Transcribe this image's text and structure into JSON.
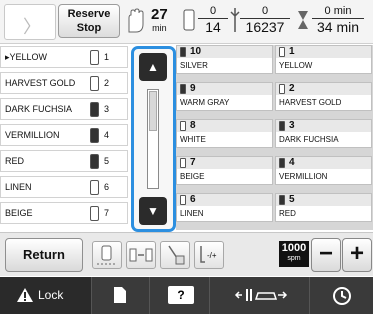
{
  "header": {
    "reserve_stop_label_line1": "Reserve",
    "reserve_stop_label_line2": "Stop",
    "time_value": "27",
    "time_unit": "min",
    "color_numerator": "0",
    "color_denominator": "14",
    "stitch_numerator": "0",
    "stitch_denominator": "16237",
    "remaining_numerator": "0 min",
    "remaining_denominator": "34 min"
  },
  "left_list": {
    "rows": [
      {
        "name": "▸YELLOW",
        "number": "1",
        "filled": false
      },
      {
        "name": "HARVEST GOLD",
        "number": "2",
        "filled": false
      },
      {
        "name": "DARK FUCHSIA",
        "number": "3",
        "filled": true
      },
      {
        "name": "VERMILLION",
        "number": "4",
        "filled": true
      },
      {
        "name": "RED",
        "number": "5",
        "filled": true
      },
      {
        "name": "LINEN",
        "number": "6",
        "filled": false
      },
      {
        "name": "BEIGE",
        "number": "7",
        "filled": false
      }
    ]
  },
  "scroll": {
    "up_label": "▲",
    "down_label": "▼"
  },
  "grid": {
    "left_column": [
      {
        "number": "10",
        "name": "SILVER",
        "filled": true
      },
      {
        "number": "9",
        "name": "WARM GRAY",
        "filled": true
      },
      {
        "number": "8",
        "name": "WHITE",
        "filled": false
      },
      {
        "number": "7",
        "name": "BEIGE",
        "filled": false
      },
      {
        "number": "6",
        "name": "LINEN",
        "filled": false
      }
    ],
    "right_column": [
      {
        "number": "1",
        "name": "YELLOW",
        "filled": false
      },
      {
        "number": "2",
        "name": "HARVEST GOLD",
        "filled": false
      },
      {
        "number": "3",
        "name": "DARK FUCHSIA",
        "filled": true
      },
      {
        "number": "4",
        "name": "VERMILLION",
        "filled": true
      },
      {
        "number": "5",
        "name": "RED",
        "filled": true
      }
    ]
  },
  "toolbar": {
    "return_label": "Return",
    "speed_value": "1000",
    "speed_unit": "spm",
    "minus_label": "−",
    "plus_label": "+",
    "tension_label": "-/+"
  },
  "bottombar": {
    "lock_label": "Lock",
    "help_label": "?"
  },
  "colors": {
    "scroll_frame": "#2c8fe0",
    "bottom_bar": "#3a3a3a"
  }
}
